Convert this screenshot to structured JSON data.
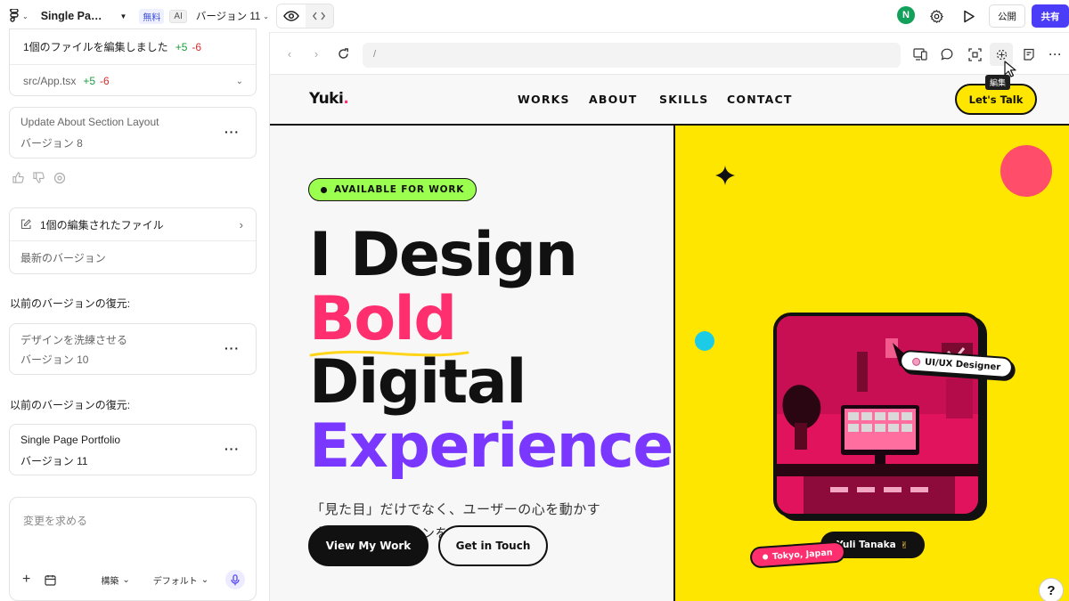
{
  "topbar": {
    "project_name": "Single Pa…",
    "free_tag": "無料",
    "ai_tag": "AI",
    "version_select": "バージョン 11",
    "avatar_initial": "N",
    "publish_label": "公開",
    "share_label": "共有"
  },
  "sidebar": {
    "files_edited_title": "1個のファイルを編集しました",
    "files_edited_plus": "+5",
    "files_edited_minus": "-6",
    "file_name": "src/App.tsx",
    "file_plus": "+5",
    "file_minus": "-6",
    "version8_title": "Update About Section Layout",
    "version8_label": "バージョン 8",
    "edited_file_link": "1個の編集されたファイル",
    "latest_version": "最新のバージョン",
    "restore_label_1": "以前のバージョンの復元:",
    "version10_title": "デザインを洗練させる",
    "version10_label": "バージョン 10",
    "restore_label_2": "以前のバージョンの復元:",
    "version11_title": "Single Page Portfolio",
    "version11_label": "バージョン 11",
    "composer_placeholder": "変更を求める",
    "composer_structure": "構築",
    "composer_model": "デフォルト"
  },
  "browser": {
    "url": "/",
    "tooltip": "編集"
  },
  "site": {
    "brand": "Yuki",
    "brand_dot": ".",
    "nav": [
      "WORKS",
      "ABOUT",
      "SKILLS",
      "CONTACT"
    ],
    "cta_talk": "Let's Talk",
    "availability": "AVAILABLE FOR WORK",
    "headline": [
      "I Design",
      "Bold",
      "Digital",
      "Experiences"
    ],
    "tagline": [
      "「見た目」だけでなく、ユーザーの心を動かす",
      "「伝わる」デザインを。"
    ],
    "cta_work": "View My Work",
    "cta_touch": "Get in Touch",
    "role_badge": "UI/UX Designer",
    "name_badge": "Yuli Tanaka",
    "location_badge": "Tokyo, Japan",
    "help": "?"
  },
  "colors": {
    "accent_yellow": "#ffe600",
    "accent_pink": "#ff2e6e",
    "accent_purple": "#7a37ff",
    "accent_green": "#9bff4f",
    "share_button": "#4b3cf7"
  }
}
